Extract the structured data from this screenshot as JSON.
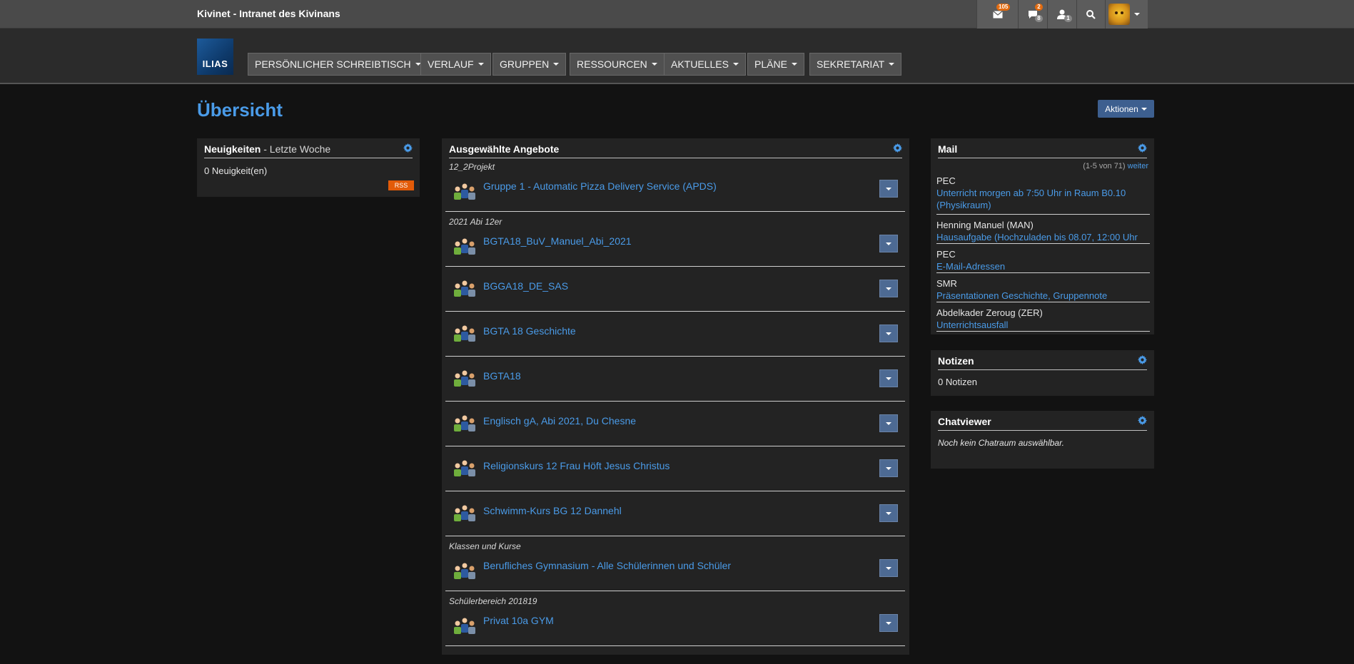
{
  "header": {
    "site_title": "Kivinet - Intranet des Kivinans",
    "mail_badge": "105",
    "chat_badge_new": "2",
    "chat_badge_total": "8",
    "contacts_badge": "1"
  },
  "nav": {
    "logo_text": "ILIAS",
    "items": [
      "PERSÖNLICHER SCHREIBTISCH",
      "VERLAUF",
      "GRUPPEN",
      "RESSOURCEN",
      "AKTUELLES",
      "PLÄNE",
      "SEKRETARIAT"
    ]
  },
  "page": {
    "title": "Übersicht",
    "actions_label": "Aktionen"
  },
  "news": {
    "title": "Neuigkeiten",
    "subtitle": " - Letzte Woche",
    "count_text": "0 Neuigkeit(en)",
    "rss_label": "RSS"
  },
  "offers": {
    "title": "Ausgewählte Angebote",
    "groups": [
      {
        "label": "12_2Projekt",
        "items": [
          "Gruppe 1 - Automatic Pizza Delivery Service (APDS)"
        ]
      },
      {
        "label": "2021 Abi 12er",
        "items": [
          "BGTA18_BuV_Manuel_Abi_2021",
          "BGGA18_DE_SAS",
          "BGTA 18 Geschichte",
          "BGTA18",
          "Englisch gA, Abi 2021, Du Chesne",
          "Religionskurs 12 Frau Höft Jesus Christus",
          "Schwimm-Kurs BG 12 Dannehl"
        ]
      },
      {
        "label": "Klassen und Kurse",
        "items": [
          "Berufliches Gymnasium - Alle Schülerinnen und Schüler"
        ]
      },
      {
        "label": "Schülerbereich 201819",
        "items": [
          "Privat 10a GYM"
        ]
      }
    ]
  },
  "mail": {
    "title": "Mail",
    "range_text": "(1-5 von 71)",
    "more_label": "weiter",
    "entries": [
      {
        "from": "PEC",
        "subject": "Unterricht morgen ab 7:50 Uhr in Raum B0.10 (Physikraum)"
      },
      {
        "from": "Henning Manuel (MAN)",
        "subject": "Hausaufgabe (Hochzuladen bis 08.07, 12:00 Uhr"
      },
      {
        "from": "PEC",
        "subject": "E-Mail-Adressen"
      },
      {
        "from": "SMR",
        "subject": "Präsentationen Geschichte, Gruppennote"
      },
      {
        "from": "Abdelkader Zeroug (ZER)",
        "subject": "Unterrichtsausfall"
      }
    ]
  },
  "notes": {
    "title": "Notizen",
    "count_text": "0 Notizen"
  },
  "chat": {
    "title": "Chatviewer",
    "empty_text": "Noch kein Chatraum auswählbar."
  },
  "colors": {
    "link": "#4a9be8",
    "panel_bg": "#232323",
    "page_bg": "#121212",
    "badge": "#e26b10",
    "button": "#4d6a93"
  }
}
